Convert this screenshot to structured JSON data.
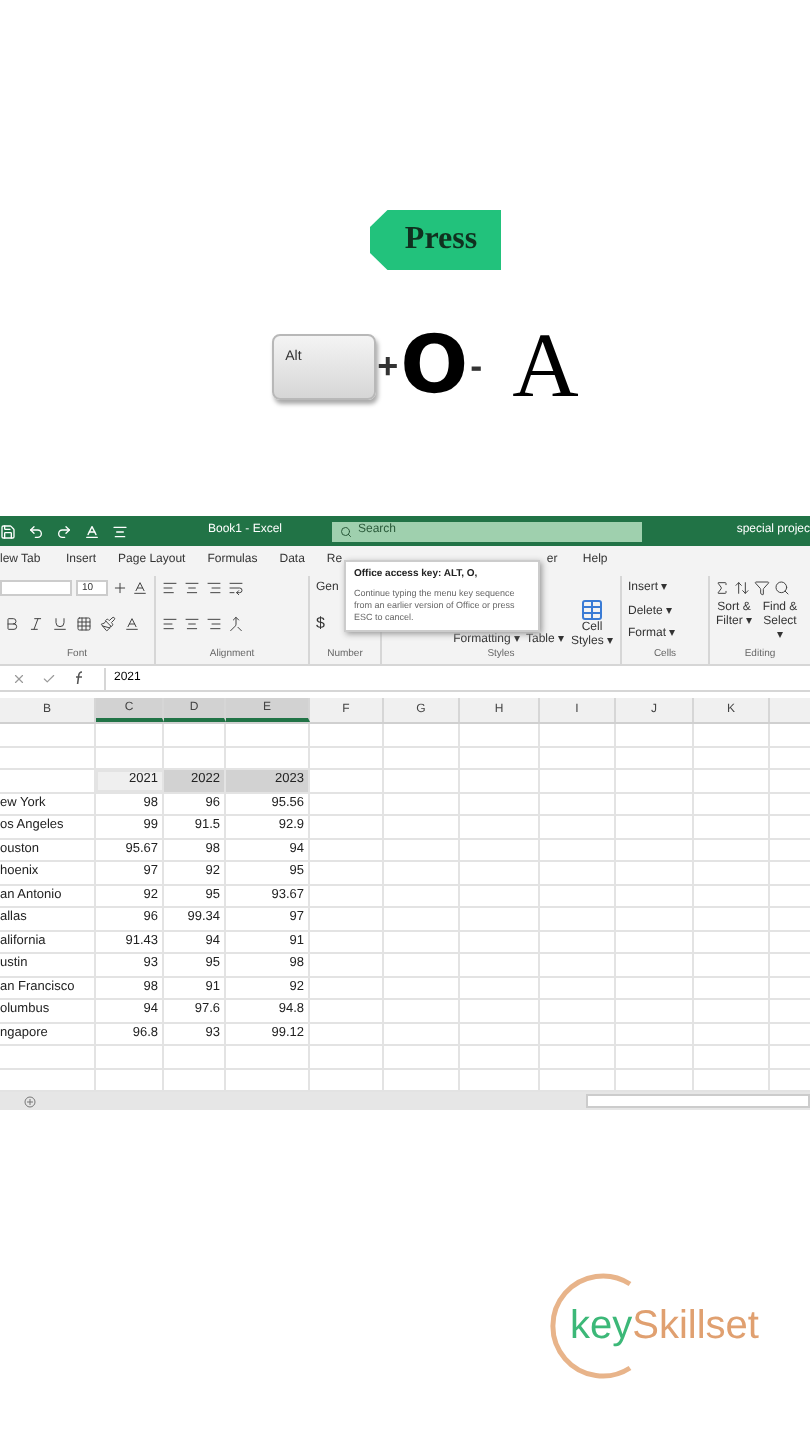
{
  "hint": {
    "tag": "Press",
    "keys": [
      {
        "kind": "key",
        "label": "Alt"
      },
      {
        "kind": "separator",
        "label": "+"
      },
      {
        "kind": "letter",
        "label": "O"
      },
      {
        "kind": "separator",
        "label": "-"
      },
      {
        "kind": "serif_letter",
        "label": "A"
      }
    ]
  },
  "window": {
    "title": "Book1 - Excel",
    "search": {
      "placeholder": "Search"
    },
    "account": "special projec"
  },
  "ribbon_tabs": [
    {
      "label": "lew Tab"
    },
    {
      "label": "Insert"
    },
    {
      "label": "Page Layout"
    },
    {
      "label": "Formulas"
    },
    {
      "label": "Data"
    },
    {
      "label": "Re"
    },
    {
      "label": "er"
    },
    {
      "label": "Help"
    }
  ],
  "tooltip": {
    "title": "Office access key: ALT, O,",
    "body": "Continue typing the menu key sequence from an earlier version of Office or press ESC to cancel."
  },
  "ribbon": {
    "font": {
      "size": "10",
      "label": "Font"
    },
    "alignment": {
      "label": "Alignment"
    },
    "number": {
      "format": "Gen",
      "currency": "$",
      "label": "Number"
    },
    "styles": {
      "buttons": [
        "Formatting ▾",
        "Table ▾",
        "Cell Styles ▾"
      ],
      "label": "Styles"
    },
    "cells": {
      "buttons": [
        "Insert ▾",
        "Delete ▾",
        "Format ▾"
      ],
      "label": "Cells"
    },
    "editing": {
      "buttons": [
        "Sort & Filter ▾",
        "Find & Select ▾"
      ],
      "label": "Editing"
    }
  },
  "formula_bar": {
    "value": "2021"
  },
  "columns": [
    {
      "label": "B",
      "selected": false
    },
    {
      "label": "C",
      "selected": true
    },
    {
      "label": "D",
      "selected": true
    },
    {
      "label": "E",
      "selected": true
    },
    {
      "label": "F",
      "selected": false
    },
    {
      "label": "G",
      "selected": false
    },
    {
      "label": "H",
      "selected": false
    },
    {
      "label": "I",
      "selected": false
    },
    {
      "label": "J",
      "selected": false
    },
    {
      "label": "K",
      "selected": false
    }
  ],
  "years": [
    {
      "label": "2021",
      "selected": true,
      "active": true
    },
    {
      "label": "2022",
      "selected": true,
      "active": false
    },
    {
      "label": "2023",
      "selected": true,
      "active": false
    }
  ],
  "rows": [
    {
      "city": "ew York",
      "values": [
        "98",
        "96",
        "95.56"
      ]
    },
    {
      "city": "os Angeles",
      "values": [
        "99",
        "91.5",
        "92.9"
      ]
    },
    {
      "city": "ouston",
      "values": [
        "95.67",
        "98",
        "94"
      ]
    },
    {
      "city": "hoenix",
      "values": [
        "97",
        "92",
        "95"
      ]
    },
    {
      "city": "an Antonio",
      "values": [
        "92",
        "95",
        "93.67"
      ]
    },
    {
      "city": "allas",
      "values": [
        "96",
        "99.34",
        "97"
      ]
    },
    {
      "city": "alifornia",
      "values": [
        "91.43",
        "94",
        "91"
      ]
    },
    {
      "city": "ustin",
      "values": [
        "93",
        "95",
        "98"
      ]
    },
    {
      "city": "an Francisco",
      "values": [
        "98",
        "91",
        "92"
      ]
    },
    {
      "city": "olumbus",
      "values": [
        "94",
        "97.6",
        "94.8"
      ]
    },
    {
      "city": "ngapore",
      "values": [
        "96.8",
        "93",
        "99.12"
      ]
    }
  ],
  "logo": {
    "first": "key",
    "second": "Skillset"
  }
}
